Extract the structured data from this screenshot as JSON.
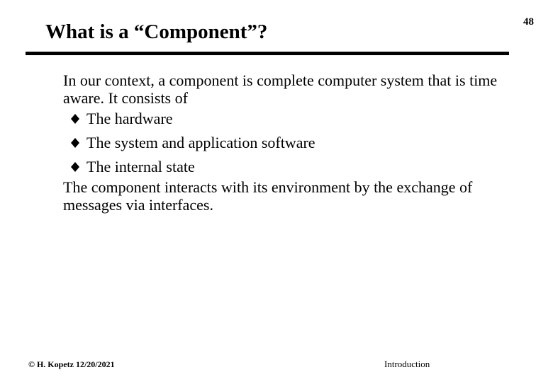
{
  "slide": {
    "title": "What is a “Component”?",
    "number": "48"
  },
  "body": {
    "intro": "In our context, a component is complete computer system that is time aware.  It consists of",
    "bullets": [
      {
        "icon": "diamond-bullet-icon",
        "text": "The hardware"
      },
      {
        "icon": "diamond-bullet-icon",
        "text": "The system and application software"
      },
      {
        "icon": "diamond-bullet-icon",
        "text": "The internal state"
      }
    ],
    "closing": "The component interacts with its environment by the exchange of messages via interfaces."
  },
  "footer": {
    "copyright": "© H. Kopetz  12/20/2021",
    "section": "Introduction"
  }
}
